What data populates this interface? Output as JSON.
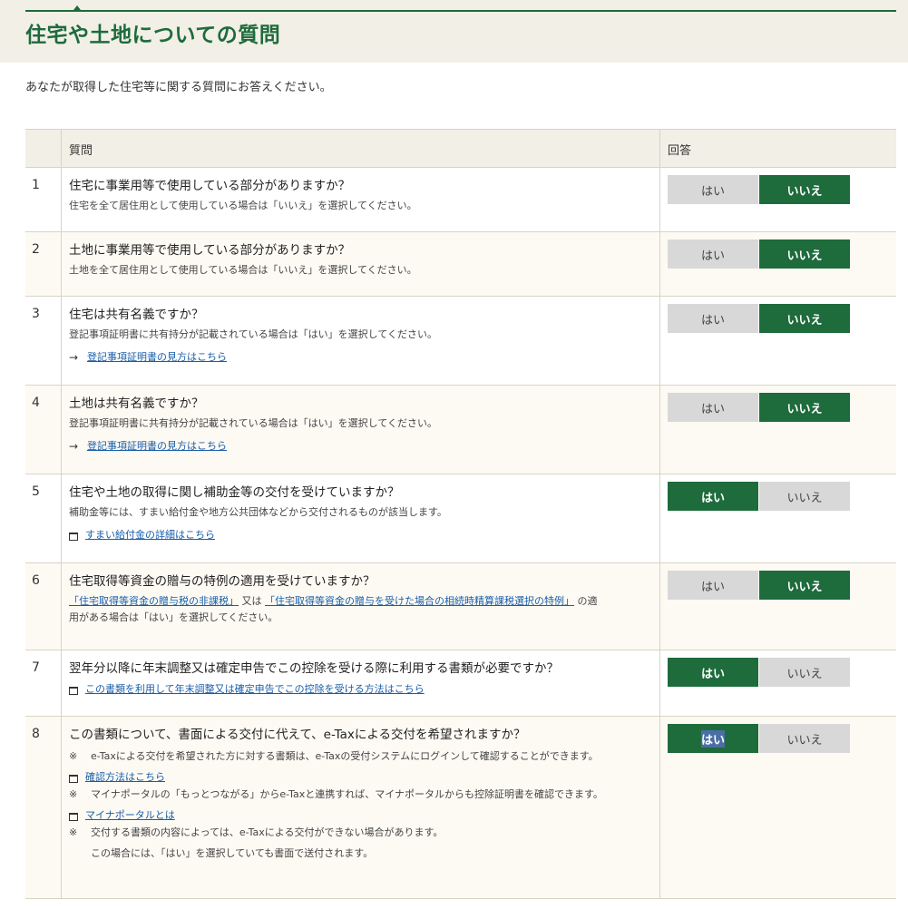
{
  "header": {
    "title": "住宅や土地についての質問"
  },
  "intro": "あなたが取得した住宅等に関する質問にお答えください。",
  "table": {
    "col_question": "質問",
    "col_answer": "回答",
    "yes_label": "はい",
    "no_label": "いいえ"
  },
  "questions": [
    {
      "num": "1",
      "text": "住宅に事業用等で使用している部分がありますか？",
      "note": "住宅を全て居住用として使用している場合は「いいえ」を選択してください。",
      "answer": "no"
    },
    {
      "num": "2",
      "text": "土地に事業用等で使用している部分がありますか？",
      "note": "土地を全て居住用として使用している場合は「いいえ」を選択してください。",
      "answer": "no"
    },
    {
      "num": "3",
      "text": "住宅は共有名義ですか？",
      "note": "登記事項証明書に共有持分が記載されている場合は「はい」を選択してください。",
      "link": "登記事項証明書の見方はこちら",
      "answer": "no"
    },
    {
      "num": "4",
      "text": "土地は共有名義ですか？",
      "note": "登記事項証明書に共有持分が記載されている場合は「はい」を選択してください。",
      "link": "登記事項証明書の見方はこちら",
      "answer": "no"
    },
    {
      "num": "5",
      "text": "住宅や土地の取得に関し補助金等の交付を受けていますか？",
      "note": "補助金等には、すまい給付金や地方公共団体などから交付されるものが該当します。",
      "link": "すまい給付金の詳細はこちら",
      "answer": "yes"
    },
    {
      "num": "6",
      "text": "住宅取得等資金の贈与の特例の適用を受けていますか？",
      "link_a": "「住宅取得等資金の贈与税の非課税」",
      "mid": "又は",
      "link_b": "「住宅取得等資金の贈与を受けた場合の相続時精算課税選択の特例」",
      "tail1": "の適",
      "tail2": "用がある場合は「はい」を選択してください。",
      "answer": "no"
    },
    {
      "num": "7",
      "text": "翌年分以降に年末調整又は確定申告でこの控除を受ける際に利用する書類が必要ですか？",
      "link": "この書類を利用して年末調整又は確定申告でこの控除を受ける方法はこちら",
      "answer": "yes"
    },
    {
      "num": "8",
      "text": "この書類について、書面による交付に代えて、e-Taxによる交付を希望されますか？",
      "mark": "※",
      "note1": "e-Taxによる交付を希望された方に対する書類は、e-Taxの受付システムにログインして確認することができます。",
      "link1": "確認方法はこちら",
      "note2": "マイナポータルの「もっとつながる」からe-Taxと連携すれば、マイナポータルからも控除証明書を確認できます。",
      "link2": "マイナポータルとは",
      "note3": "交付する書類の内容によっては、e-Taxによる交付ができない場合があります。",
      "note4": "この場合には、「はい」を選択していても書面で送付されます。",
      "answer": "yes"
    }
  ],
  "icons": {
    "arrow": "arrow-right-icon",
    "external": "new-window-icon"
  },
  "colors": {
    "accent": "#1e6b3c",
    "header_bg": "#f1efe6",
    "link": "#1a5ea8",
    "button_off": "#d8d8d8"
  }
}
